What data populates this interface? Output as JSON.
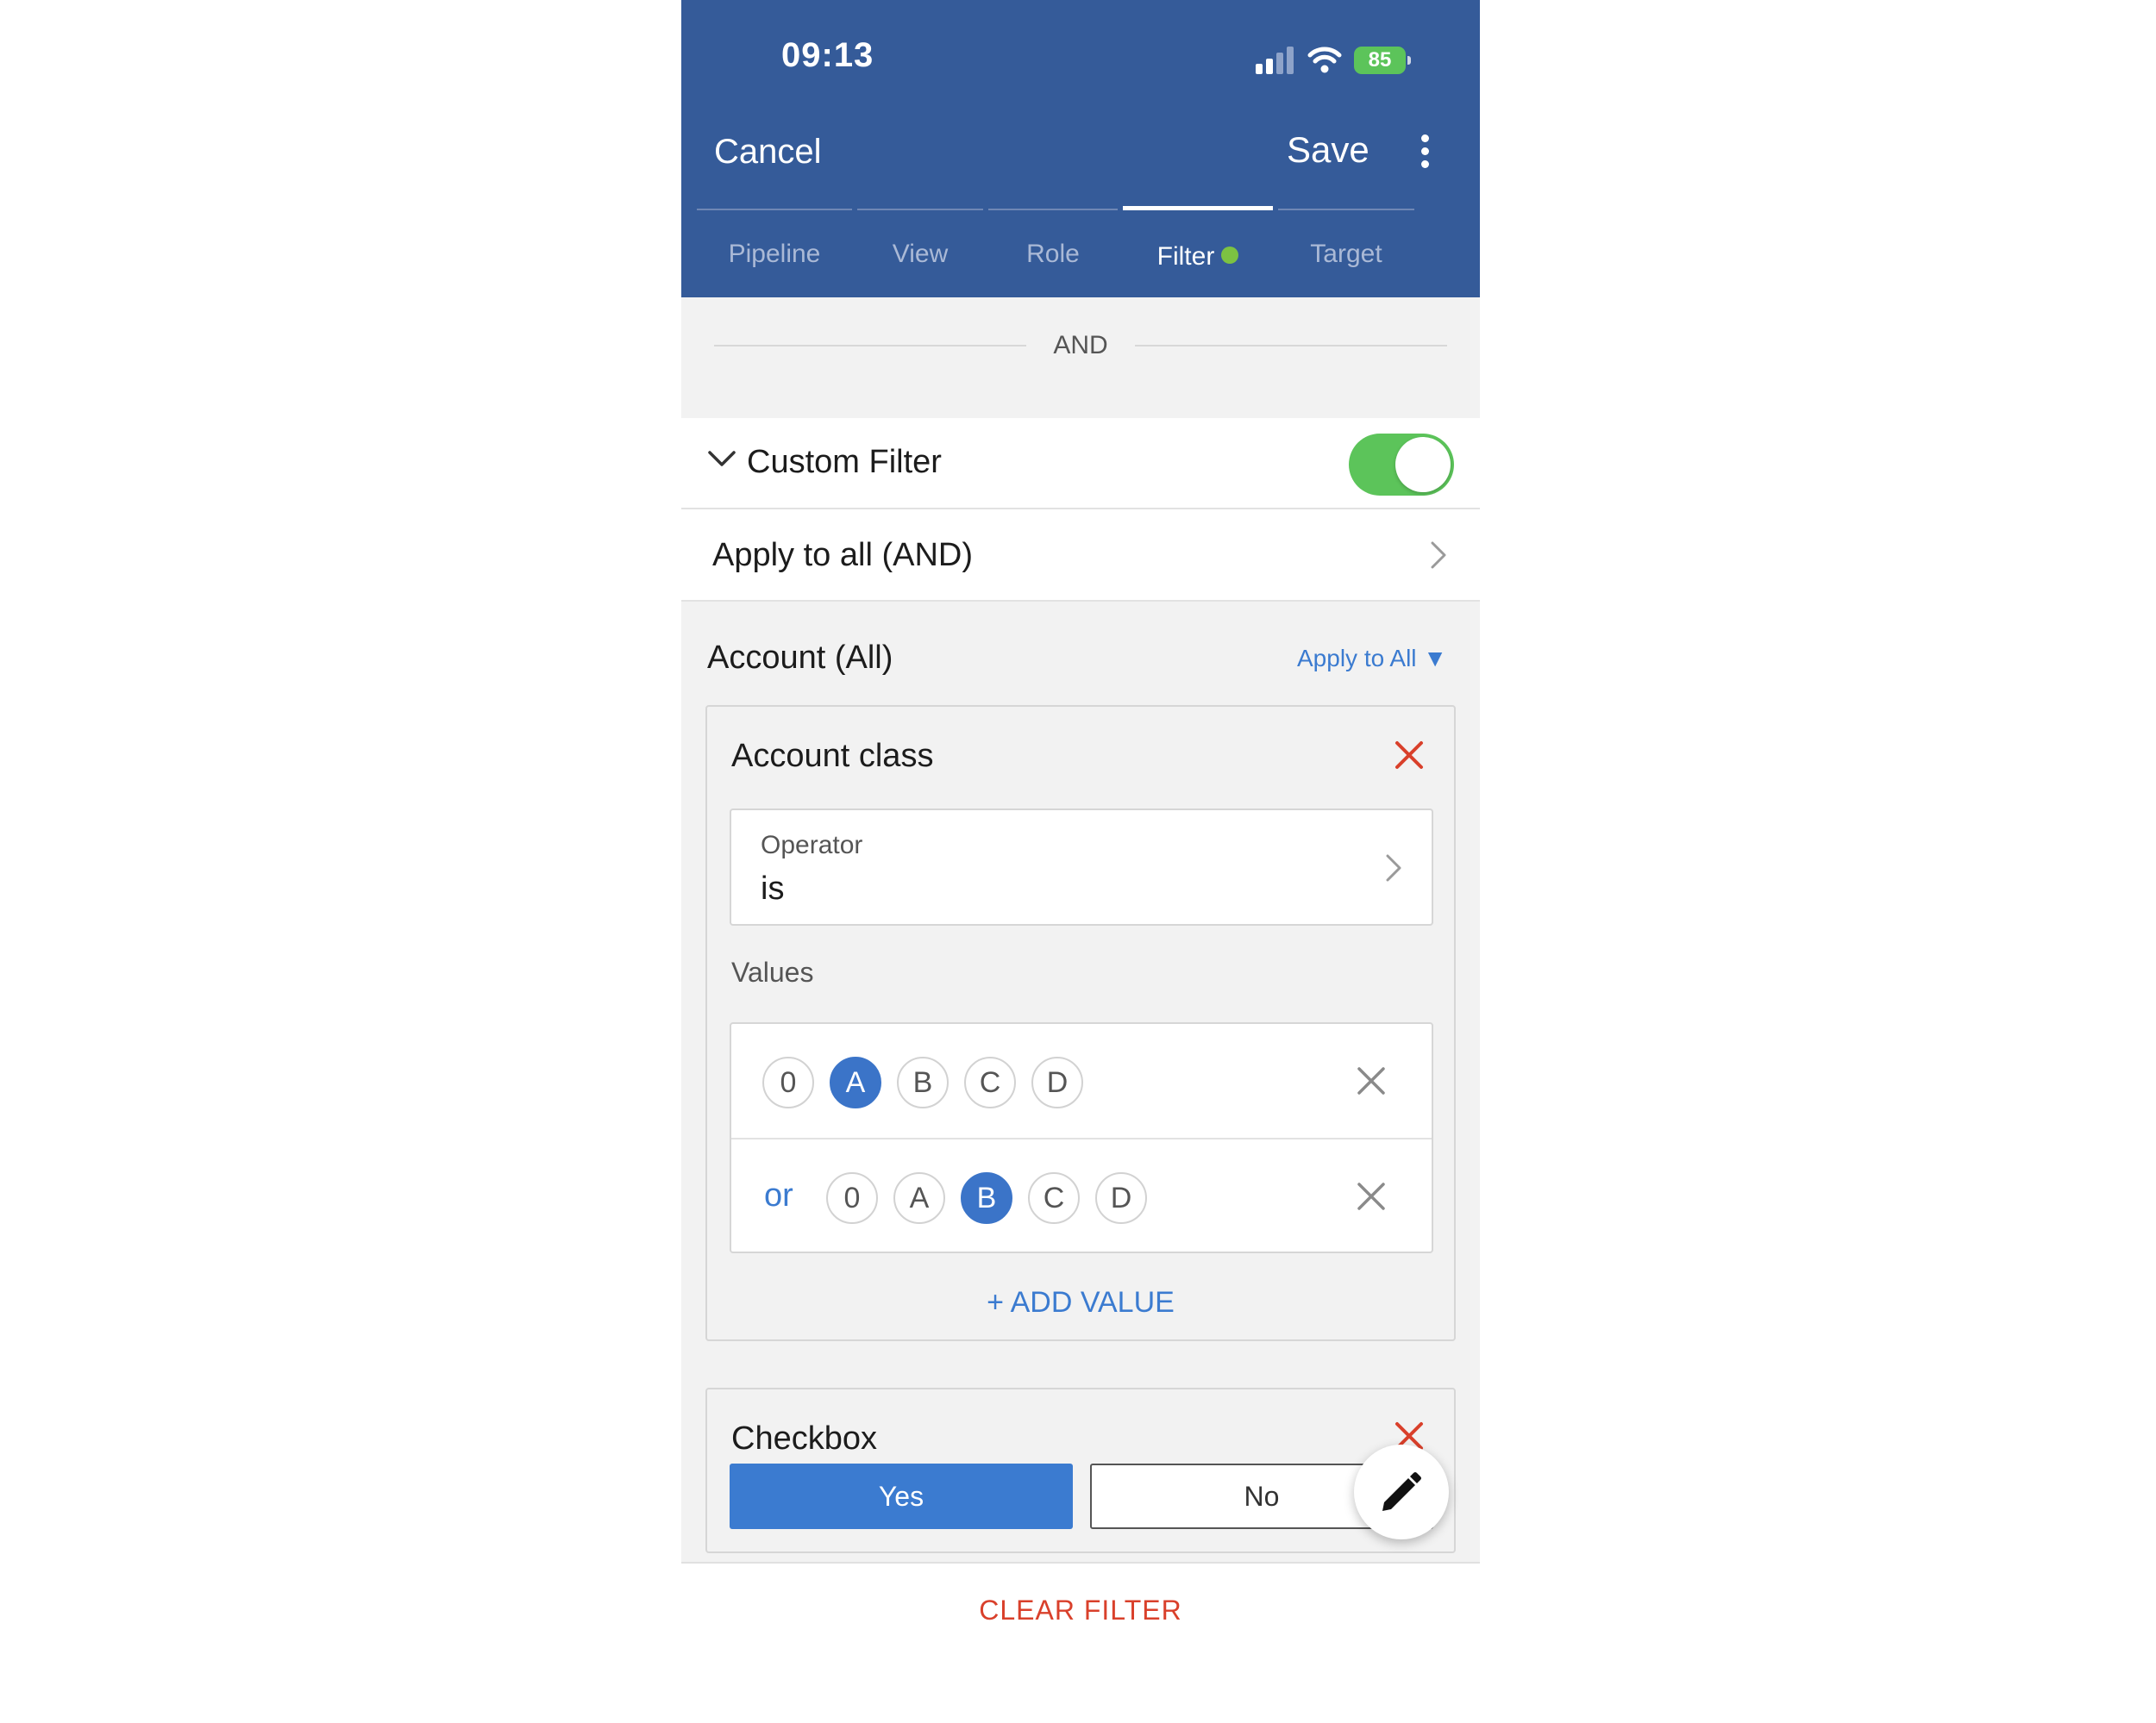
{
  "status_bar": {
    "time": "09:13",
    "battery": "85"
  },
  "header": {
    "cancel_label": "Cancel",
    "save_label": "Save",
    "tabs": [
      {
        "label": "Pipeline"
      },
      {
        "label": "View"
      },
      {
        "label": "Role"
      },
      {
        "label": "Filter",
        "active": true,
        "indicator_color": "#7cc242"
      },
      {
        "label": "Target"
      }
    ]
  },
  "separator": {
    "label": "AND"
  },
  "custom_filter": {
    "title": "Custom Filter",
    "enabled": true
  },
  "apply_row": {
    "label": "Apply to all (AND)"
  },
  "account_section": {
    "title": "Account (All)",
    "apply_link": "Apply to All ▼"
  },
  "account_class_card": {
    "title": "Account class",
    "operator_label": "Operator",
    "operator_value": "is",
    "values_label": "Values",
    "value_rows": [
      {
        "prefix": "",
        "options": [
          "0",
          "A",
          "B",
          "C",
          "D"
        ],
        "selected": "A"
      },
      {
        "prefix": "or",
        "options": [
          "0",
          "A",
          "B",
          "C",
          "D"
        ],
        "selected": "B"
      }
    ],
    "add_value_label": "+ ADD VALUE"
  },
  "checkbox_card": {
    "title": "Checkbox",
    "yes_label": "Yes",
    "no_label": "No",
    "selected": "Yes"
  },
  "footer": {
    "clear_filter_label": "CLEAR FILTER"
  },
  "colors": {
    "header_bg": "#355b99",
    "accent": "#3b7bd0",
    "toggle_on": "#5cc45a",
    "danger": "#d9402b"
  }
}
